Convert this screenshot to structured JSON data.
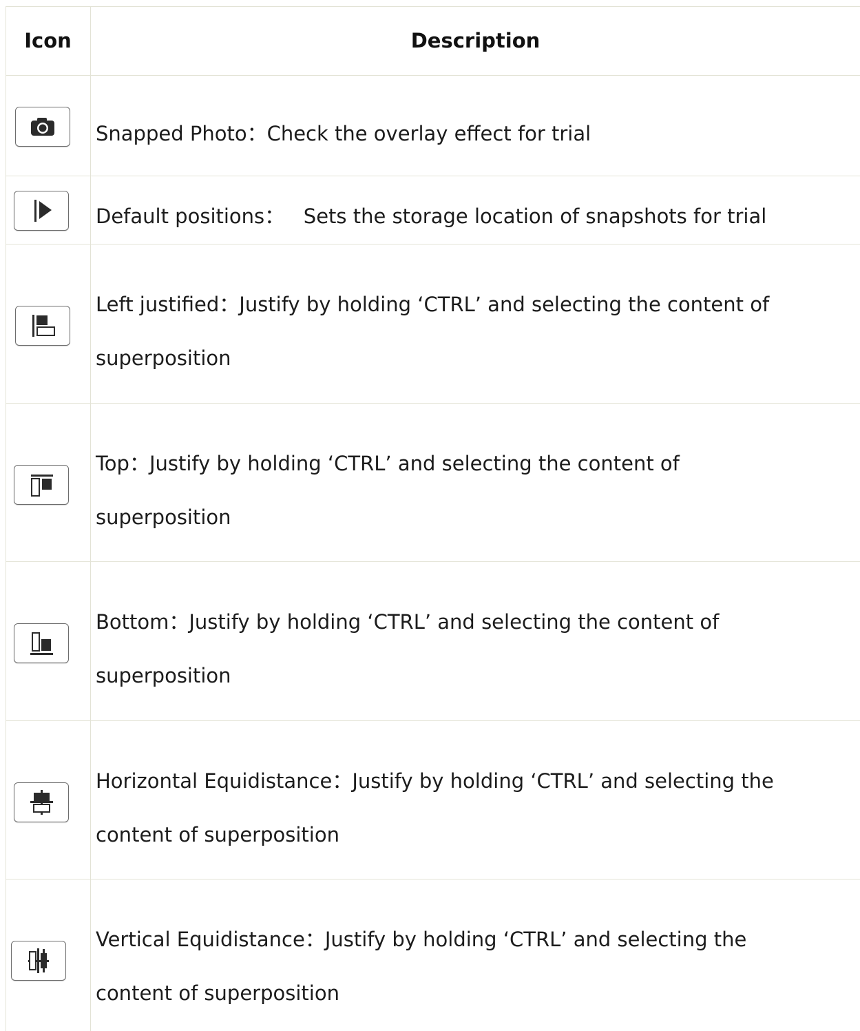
{
  "table": {
    "headers": {
      "icon": "Icon",
      "description": "Description"
    },
    "rows": [
      {
        "icon": "camera-icon",
        "line1": "Snapped Photo：Check the overlay effect for trial",
        "line2": ""
      },
      {
        "icon": "play-from-start-icon",
        "line1": "Default positions：   Sets the storage location of snapshots for trial",
        "line2": ""
      },
      {
        "icon": "align-left-icon",
        "line1": "Left justified：Justify by holding ‘CTRL’ and selecting the content of",
        "line2": "superposition"
      },
      {
        "icon": "align-top-icon",
        "line1": "Top：Justify by holding ‘CTRL’ and selecting the content of",
        "line2": "superposition"
      },
      {
        "icon": "align-bottom-icon",
        "line1": "Bottom：Justify by holding ‘CTRL’ and selecting the content of",
        "line2": "superposition"
      },
      {
        "icon": "horizontal-equidistance-icon",
        "line1": "Horizontal Equidistance：Justify by holding ‘CTRL’ and selecting the",
        "line2": "content of superposition"
      },
      {
        "icon": "vertical-equidistance-icon",
        "line1": "Vertical Equidistance：Justify by holding ‘CTRL’ and selecting the",
        "line2": "content of superposition"
      }
    ]
  }
}
